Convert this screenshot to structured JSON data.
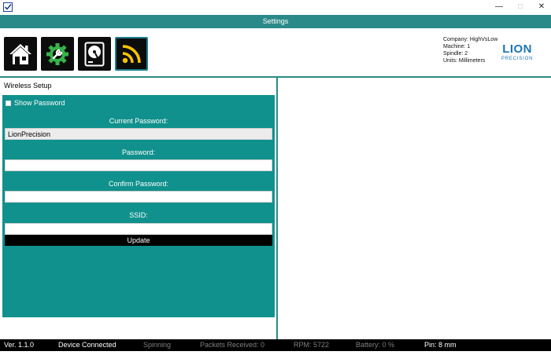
{
  "window": {
    "minimize": "—",
    "maximize": "□",
    "close": "✕",
    "icon": "checkbox-app-icon"
  },
  "header": {
    "title": "Settings"
  },
  "nav": {
    "items": [
      {
        "icon": "home-icon"
      },
      {
        "icon": "gear-wrench-icon"
      },
      {
        "icon": "hard-drive-icon"
      },
      {
        "icon": "wireless-icon",
        "active": true
      }
    ]
  },
  "info": {
    "company": "Company: HighVsLow",
    "machine": "Machine: 1",
    "spindle": "Spindle: 2",
    "units": "Units: Millimeters"
  },
  "logo": {
    "word": "LION",
    "sub": "PRECISION"
  },
  "wireless": {
    "section_title": "Wireless Setup",
    "show_password": "Show Password",
    "current_password_label": "Current Password:",
    "current_password_value": "LionPrecision",
    "password_label": "Password:",
    "password_value": "",
    "confirm_password_label": "Confirm Password:",
    "confirm_password_value": "",
    "ssid_label": "SSID:",
    "ssid_value": "",
    "update_label": "Update"
  },
  "status": {
    "version": "Ver. 1.1.0",
    "device": "Device Connected",
    "spinning": "Spinning",
    "packets": "Packets Received:  0",
    "rpm": "RPM:  5722",
    "battery": "Battery:  0  %",
    "pin": "Pin: 8 mm"
  },
  "colors": {
    "teal": "#10918d",
    "header_teal": "#2a8a89",
    "logo_blue": "#1a75b5",
    "icon_green": "#37b34a",
    "icon_yellow": "#f5c400"
  }
}
